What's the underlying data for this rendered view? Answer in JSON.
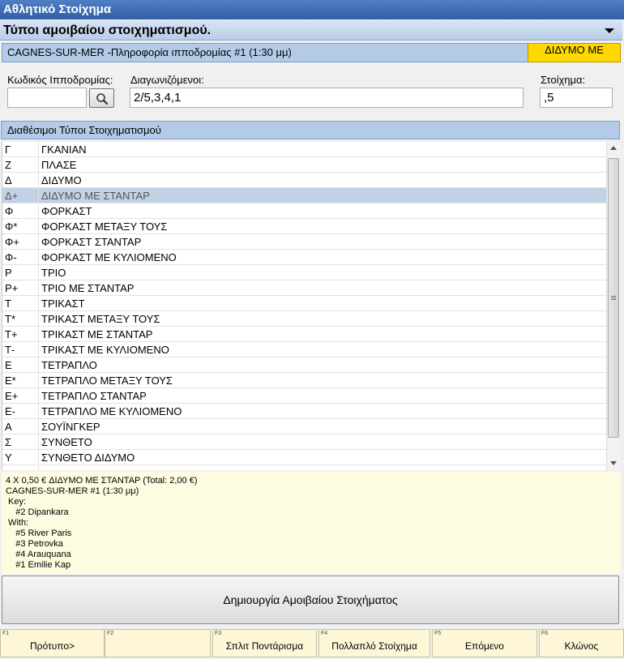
{
  "window": {
    "title": "Αθλητικό Στοίχημα"
  },
  "panel": {
    "title": "Τύποι αμοιβαίου στοιχηματισμού."
  },
  "race_bar": {
    "info": "CAGNES-SUR-MER -Πληροφορία ιπποδρομίας #1 (1:30 μμ)",
    "selected_type": "ΔΙΔΥΜΟ ΜΕ"
  },
  "form": {
    "track_code_label": "Κωδικός Ιπποδρομίας:",
    "track_code_value": "",
    "runners_label": "Διαγωνιζόμενοι:",
    "runners_value": "2/5,3,4,1",
    "stake_label": "Στοίχημα:",
    "stake_value": ",5"
  },
  "list": {
    "header": "Διαθέσιμοι Τύποι Στοιχηματισμού",
    "items": [
      {
        "code": "Γ",
        "name": "ΓΚΑΝΙΑΝ"
      },
      {
        "code": "Ζ",
        "name": "ΠΛΑΣΕ"
      },
      {
        "code": "Δ",
        "name": "ΔΙΔΥΜΟ"
      },
      {
        "code": "Δ+",
        "name": "ΔΙΔΥΜΟ ΜΕ ΣΤΑΝΤΑΡ"
      },
      {
        "code": "Φ",
        "name": "ΦΟΡΚΑΣΤ"
      },
      {
        "code": "Φ*",
        "name": "ΦΟΡΚΑΣΤ ΜΕΤΑΞΥ ΤΟΥΣ"
      },
      {
        "code": "Φ+",
        "name": "ΦΟΡΚΑΣΤ ΣΤΑΝΤΑΡ"
      },
      {
        "code": "Φ-",
        "name": "ΦΟΡΚΑΣΤ ΜΕ ΚΥΛΙΟΜΕΝΟ"
      },
      {
        "code": "Ρ",
        "name": "ΤΡΙΟ"
      },
      {
        "code": "Ρ+",
        "name": "ΤΡΙΟ ΜΕ ΣΤΑΝΤΑΡ"
      },
      {
        "code": "Τ",
        "name": "ΤΡΙΚΑΣΤ"
      },
      {
        "code": "Τ*",
        "name": "ΤΡΙΚΑΣΤ ΜΕΤΑΞΥ ΤΟΥΣ"
      },
      {
        "code": "Τ+",
        "name": "ΤΡΙΚΑΣΤ ΜΕ ΣΤΑΝΤΑΡ"
      },
      {
        "code": "Τ-",
        "name": "ΤΡΙΚΑΣΤ ΜΕ ΚΥΛΙΟΜΕΝΟ"
      },
      {
        "code": "Ε",
        "name": "ΤΕΤΡΑΠΛΟ"
      },
      {
        "code": "Ε*",
        "name": "ΤΕΤΡΑΠΛΟ ΜΕΤΑΞΥ ΤΟΥΣ"
      },
      {
        "code": "Ε+",
        "name": "ΤΕΤΡΑΠΛΟ ΣΤΑΝΤΑΡ"
      },
      {
        "code": "Ε-",
        "name": "ΤΕΤΡΑΠΛΟ ΜΕ ΚΥΛΙΟΜΕΝΟ"
      },
      {
        "code": "Α",
        "name": "ΣΟΥΪΝΓΚΕΡ"
      },
      {
        "code": "Σ",
        "name": "ΣΥΝΘΕΤΟ"
      },
      {
        "code": "Υ",
        "name": "ΣΥΝΘΕΤΟ ΔΙΔΥΜΟ"
      },
      {
        "code": "",
        "name": ""
      }
    ],
    "selected_index": 3
  },
  "summary": {
    "lines": [
      "4 X 0,50 € ΔΙΔΥΜΟ ΜΕ ΣΤΑΝΤΑΡ (Total: 2,00 €)",
      "CAGNES-SUR-MER #1 (1:30 μμ)",
      " Key:",
      "    #2 Dipankara",
      " With:",
      "    #5 River Paris",
      "    #3 Petrovka",
      "    #4 Arauquana",
      "    #1 Emilie Kap"
    ]
  },
  "create_button": "Δημιουργία Αμοιβαίου Στοιχήματος",
  "function_keys": [
    {
      "key": "F1",
      "label": "Πρότυπο>"
    },
    {
      "key": "F2",
      "label": ""
    },
    {
      "key": "F3",
      "label": "Σπλιτ Ποντάρισμα"
    },
    {
      "key": "F4",
      "label": "Πολλαπλό Στοίχημα"
    },
    {
      "key": "F5",
      "label": "Επόμενο"
    },
    {
      "key": "F6",
      "label": "Κλώνος"
    }
  ],
  "colors": {
    "title_blue": "#3a6ab3",
    "header_blue": "#b4cbe8",
    "highlight_yellow": "#ffd800",
    "summary_bg": "#fdfbe0",
    "selected_row": "#c2d2e6"
  }
}
